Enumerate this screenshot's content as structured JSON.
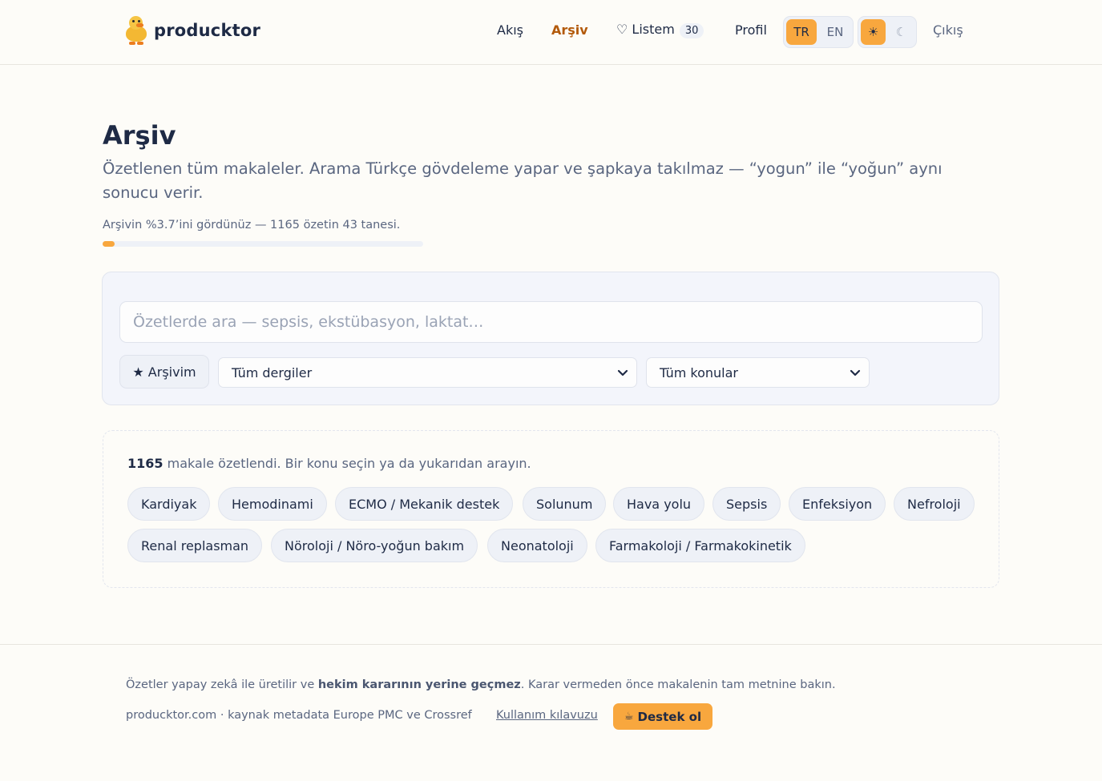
{
  "brand": {
    "name": "producktor",
    "logo_icon": "duck-icon"
  },
  "nav": {
    "feed": "Akış",
    "archive": "Arşiv",
    "mylist_label": "♡ Listem",
    "mylist_count": "30",
    "profile": "Profil",
    "lang_tr": "TR",
    "lang_en": "EN",
    "theme_light": "☀",
    "theme_dark": "☾",
    "logout": "Çıkış"
  },
  "page": {
    "title": "Arşiv",
    "subtitle": "Özetlenen tüm makaleler. Arama Türkçe gövdeleme yapar ve şapkaya takılmaz — “yogun” ile “yoğun” aynı sonucu verir.",
    "progress_text": "Arşivin %3.7’ini gördünüz — 1165 özetin 43 tanesi.",
    "progress_fraction": 0.037
  },
  "search": {
    "placeholder": "Özetlerde ara — sepsis, ekstübasyon, laktat…",
    "value": "",
    "favorites_label": "★ Arşivim",
    "journal_select": "Tüm dergiler",
    "topic_select": "Tüm konular"
  },
  "topics": {
    "count": "1165",
    "intro_rest": " makale özetlendi. Bir konu seçin ya da yukarıdan arayın.",
    "items": [
      "Kardiyak",
      "Hemodinami",
      "ECMO / Mekanik destek",
      "Solunum",
      "Hava yolu",
      "Sepsis",
      "Enfeksiyon",
      "Nefroloji",
      "Renal replasman",
      "Nöroloji / Nöro-yoğun bakım",
      "Neonatoloji",
      "Farmakoloji / Farmakokinetik"
    ]
  },
  "footer": {
    "disclaimer_start": "Özetler yapay zekâ ile üretilir ve ",
    "disclaimer_bold": "hekim kararının yerine geçmez",
    "disclaimer_end": ". Karar vermeden önce makalenin tam metnine bakın.",
    "meta": "producktor.com · kaynak metadata Europe PMC ve Crossref",
    "guide_link": "Kullanım kılavuzu",
    "support_icon": "☕",
    "support_label": "Destek ol"
  },
  "colors": {
    "accent": "#f8a73e",
    "active_nav": "#b35a0b",
    "text": "#1e2a45",
    "muted": "#5a6680",
    "background": "#fdfcf8"
  }
}
